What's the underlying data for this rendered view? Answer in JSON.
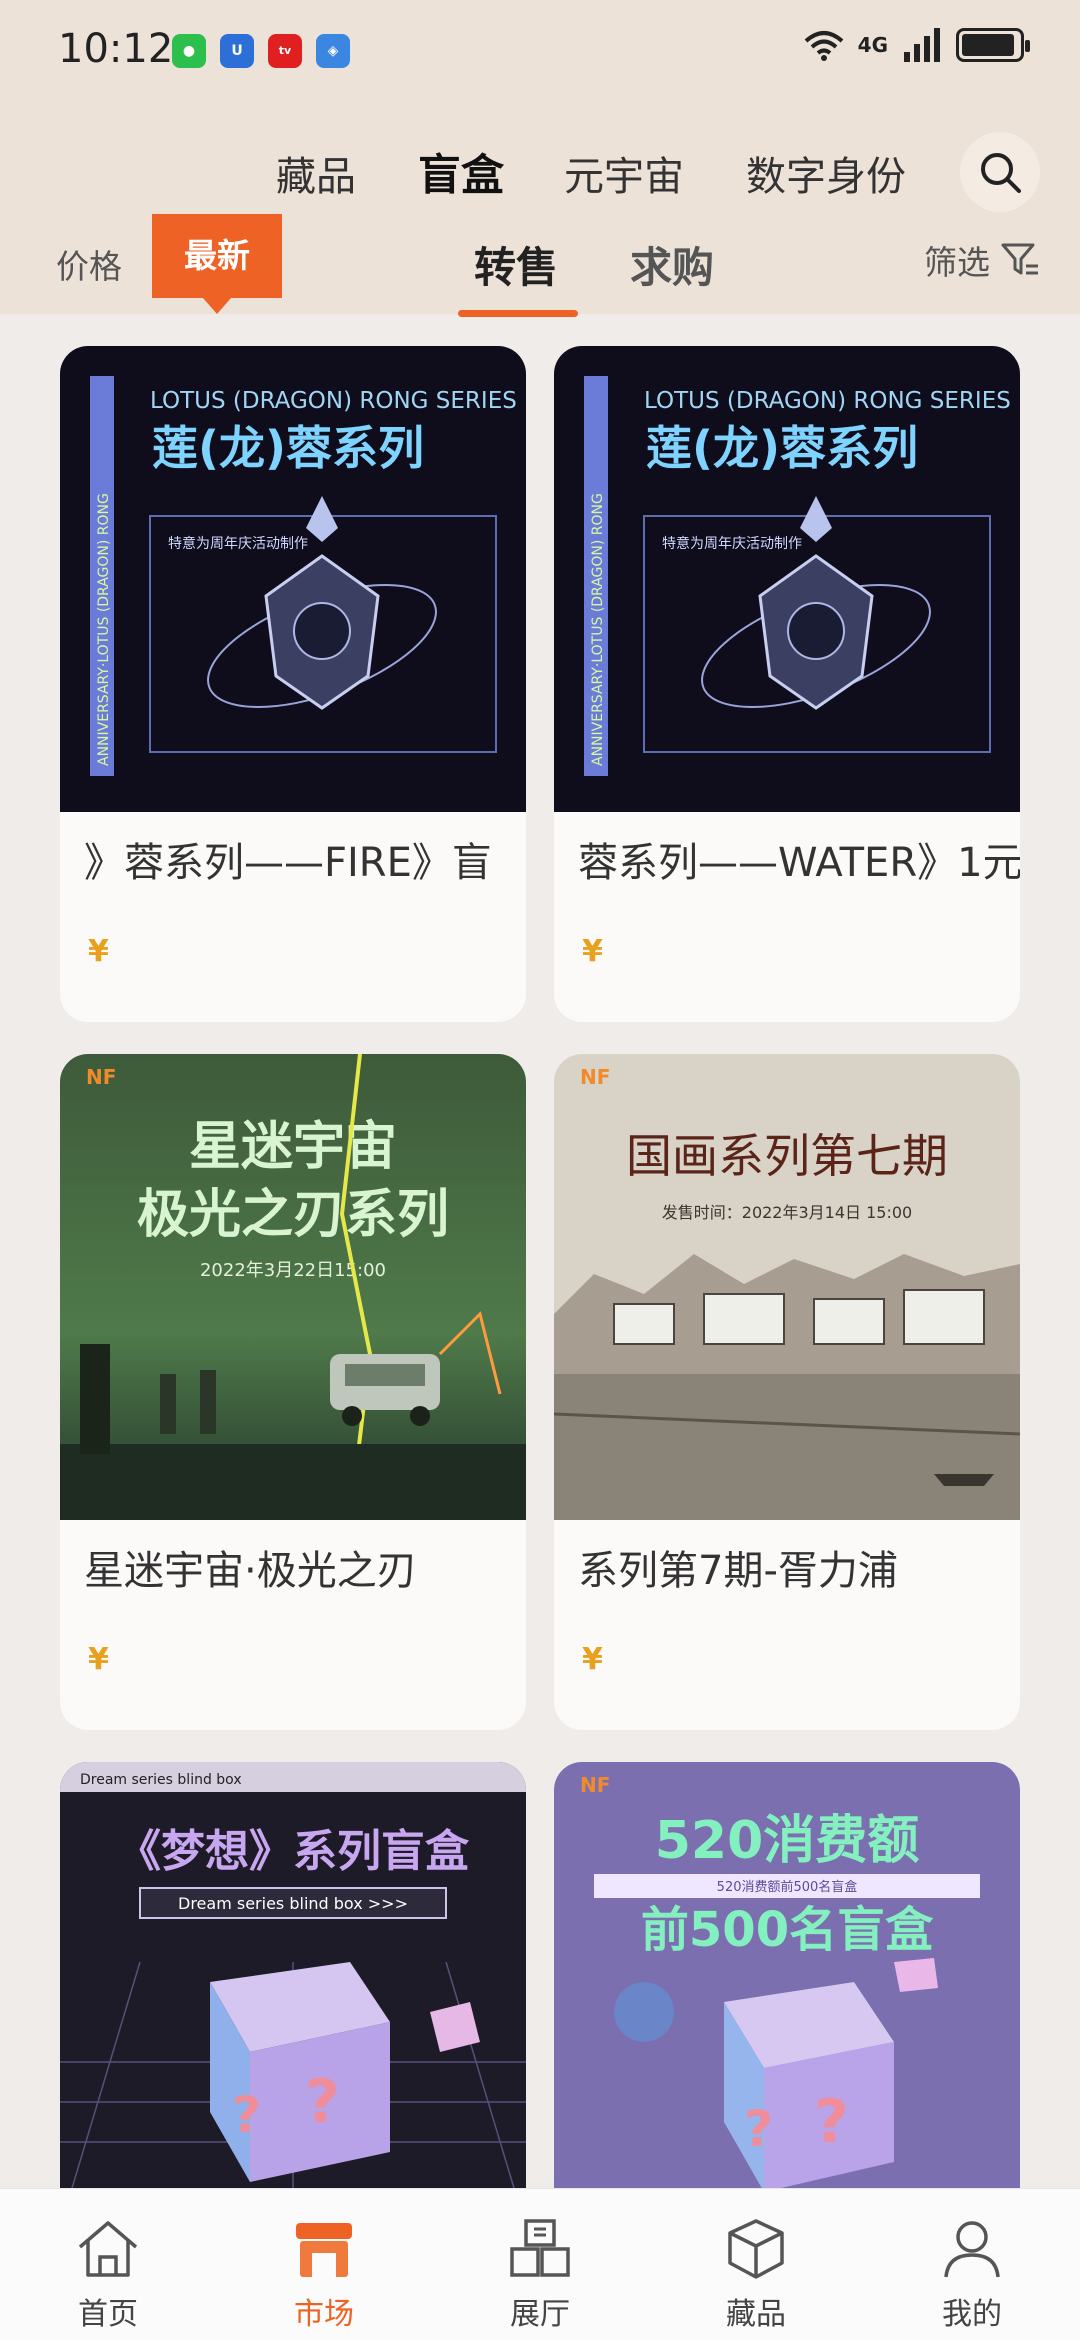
{
  "status_bar": {
    "time": "10:12",
    "app_icons": [
      {
        "name": "wechat-icon",
        "color": "#2dbf4c",
        "glyph": "◉"
      },
      {
        "name": "app-u-icon",
        "color": "#2c6fd6",
        "glyph": "U"
      },
      {
        "name": "app-red-icon",
        "color": "#e02020",
        "glyph": "tv"
      },
      {
        "name": "app-blue-icon",
        "color": "#3a86e0",
        "glyph": "◈"
      }
    ],
    "network": "4G"
  },
  "categories": [
    "藏品",
    "盲盒",
    "元宇宙",
    "数字身份"
  ],
  "active_category": "盲盒",
  "sort": {
    "price": "价格",
    "latest": "最新"
  },
  "tabs": {
    "resale": "转售",
    "wanted": "求购"
  },
  "filter_label": "筛选",
  "cards": [
    {
      "title": "》蓉系列——FIRE》盲",
      "price": "¥",
      "art": {
        "type": "lotus",
        "header": "LOTUS (DRAGON) RONG SERIES",
        "cn": "莲(龙)蓉系列",
        "note": "特意为周年庆活动制作",
        "side": "ANNIVERSARY·LOTUS (DRAGON) RONG"
      }
    },
    {
      "title": "蓉系列——WATER》1元",
      "price": "¥",
      "art": {
        "type": "lotus",
        "header": "LOTUS (DRAGON) RONG SERIES",
        "cn": "莲(龙)蓉系列",
        "note": "特意为周年庆活动制作",
        "side": "ANNIVERSARY·LOTUS (DRAGON) RONG"
      }
    },
    {
      "title": "星迷宇宙·极光之刃",
      "price": "¥",
      "art": {
        "type": "aurora",
        "brand": "NF",
        "line1": "星迷宇宙",
        "line2": "极光之刃系列",
        "date": "2022年3月22日15:00"
      }
    },
    {
      "title": "系列第7期-胥力浦",
      "price": "¥",
      "art": {
        "type": "painting",
        "brand": "NF",
        "title": "国画系列第七期",
        "date": "发售时间：2022年3月14日 15:00"
      }
    },
    {
      "title": "",
      "price": "",
      "art": {
        "type": "dream",
        "top": "Dream series blind box",
        "cn": "《梦想》系列盲盒",
        "sub": "Dream series blind box >>>"
      }
    },
    {
      "title": "",
      "price": "",
      "art": {
        "type": "promo",
        "brand": "NF",
        "line1": "520消费额",
        "line2": "前500名盲盒",
        "small": "520消费额前500名盲盒"
      }
    }
  ],
  "bottom_nav": [
    {
      "label": "首页",
      "icon": "home-icon"
    },
    {
      "label": "市场",
      "icon": "market-icon",
      "active": true
    },
    {
      "label": "展厅",
      "icon": "gallery-icon"
    },
    {
      "label": "藏品",
      "icon": "collection-icon"
    },
    {
      "label": "我的",
      "icon": "profile-icon"
    }
  ],
  "colors": {
    "accent": "#ee6225",
    "price": "#e8a11f",
    "header_bg": "#ece2d8"
  }
}
